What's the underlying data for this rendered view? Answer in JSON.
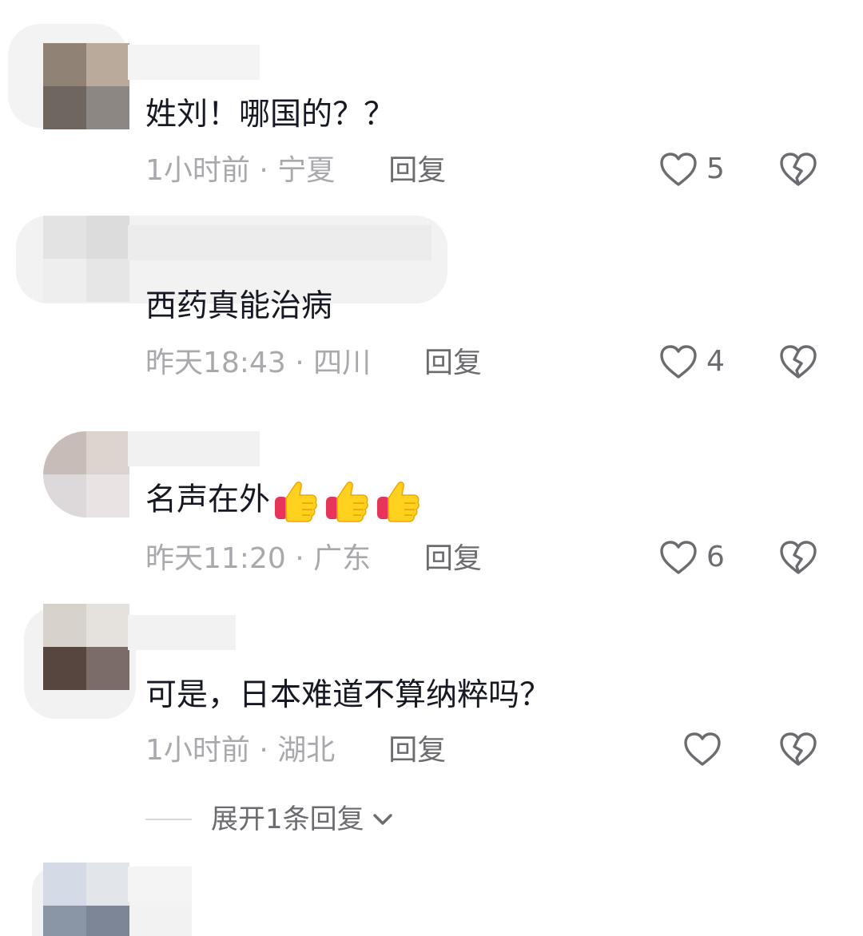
{
  "comments": [
    {
      "text": "姓刘！哪国的？？",
      "time": "1小时前",
      "location": "宁夏",
      "reply_label": "回复",
      "likes": "5"
    },
    {
      "text": "西药真能治病",
      "time": "昨天18:43",
      "location": "四川",
      "reply_label": "回复",
      "likes": "4"
    },
    {
      "text": "名声在外",
      "time": "昨天11:20",
      "location": "广东",
      "reply_label": "回复",
      "likes": "6"
    },
    {
      "text": "可是，日本难道不算纳粹吗？",
      "time": "1小时前",
      "location": "湖北",
      "reply_label": "回复",
      "likes": ""
    }
  ],
  "separator": "·",
  "expand_replies": "展开1条回复",
  "icons": {
    "like": "heart-outline-icon",
    "dislike": "broken-heart-icon",
    "expand": "chevron-down-icon",
    "emoji": "thumbs-up-emoji"
  },
  "colors": {
    "text": "#161823",
    "meta": "#a8a8ad",
    "icon": "#6b6b70"
  }
}
